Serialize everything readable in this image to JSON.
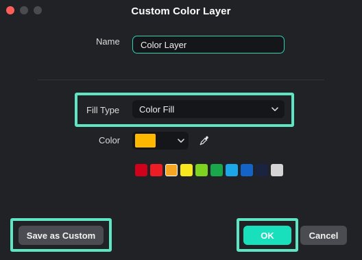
{
  "window": {
    "title": "Custom Color Layer"
  },
  "form": {
    "name_label": "Name",
    "name_value": "Color Layer",
    "fill_type_label": "Fill Type",
    "fill_type_value": "Color Fill",
    "color_label": "Color",
    "selected_color": "#ffb800",
    "preset_colors": [
      "#d0021b",
      "#ee1c25",
      "#f5a623",
      "#f8e71c",
      "#7ed321",
      "#1aa64a",
      "#1ba7e8",
      "#1363c9",
      "#1a2340",
      "#d4d4d4"
    ],
    "selected_preset_index": 2
  },
  "buttons": {
    "save_custom": "Save as Custom",
    "ok": "OK",
    "cancel": "Cancel"
  },
  "colors": {
    "accent": "#18e0bd",
    "highlight": "#5ee6c4"
  },
  "icons": {
    "fill_type_chevron": "chevron-down-icon",
    "color_chevron": "chevron-down-icon",
    "eyedropper": "eyedropper-icon"
  }
}
